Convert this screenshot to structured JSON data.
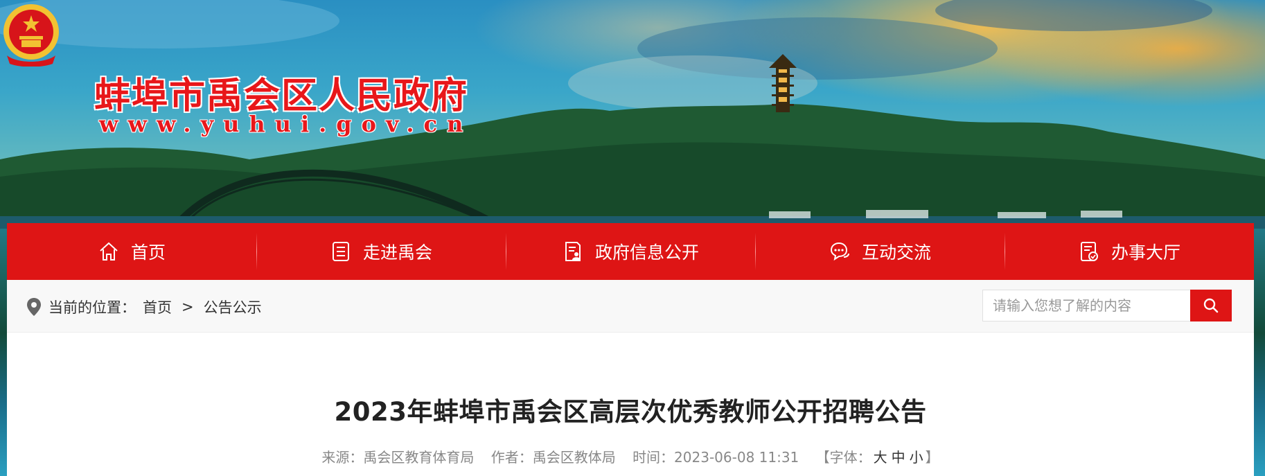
{
  "site": {
    "title": "蚌埠市禹会区人民政府",
    "domain": "www.yuhui.gov.cn",
    "emblem_icon": "national-emblem-icon"
  },
  "colors": {
    "brand_red": "#de1515",
    "title_red": "#e8171a",
    "breadcrumb_bg": "#f8f8f8"
  },
  "nav": {
    "items": [
      {
        "label": "首页",
        "icon": "home-icon"
      },
      {
        "label": "走进禹会",
        "icon": "list-icon"
      },
      {
        "label": "政府信息公开",
        "icon": "document-person-icon"
      },
      {
        "label": "互动交流",
        "icon": "chat-bubbles-icon"
      },
      {
        "label": "办事大厅",
        "icon": "document-check-icon"
      }
    ]
  },
  "breadcrumb": {
    "prefix": "当前的位置：",
    "items": [
      "首页",
      "公告公示"
    ],
    "separator": ">"
  },
  "search": {
    "placeholder": "请输入您想了解的内容",
    "icon": "search-icon"
  },
  "article": {
    "title": "2023年蚌埠市禹会区高层次优秀教师公开招聘公告",
    "source": "来源：禹会区教育体育局",
    "author": "作者：禹会区教体局",
    "time": "时间：2023-06-08 11:31",
    "fontsize_prefix": "【字体：",
    "fontsize_large": "大",
    "fontsize_medium": "中",
    "fontsize_small": "小",
    "fontsize_suffix": "】"
  }
}
